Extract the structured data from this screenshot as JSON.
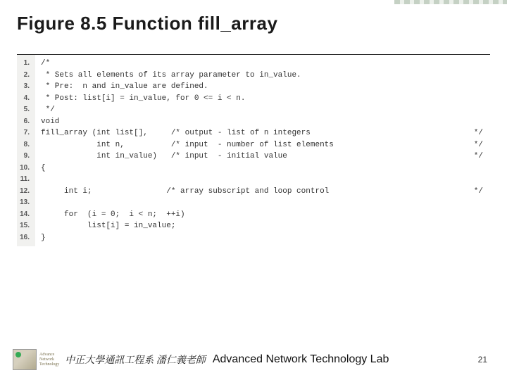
{
  "title": "Figure 8.5  Function fill_array",
  "lines": [
    {
      "n": "1.",
      "l": "/*"
    },
    {
      "n": "2.",
      "l": " * Sets all elements of its array parameter to in_value."
    },
    {
      "n": "3.",
      "l": " * Pre:  n and in_value are defined."
    },
    {
      "n": "4.",
      "l": " * Post: list[i] = in_value, for 0 <= i < n."
    },
    {
      "n": "5.",
      "l": " */"
    },
    {
      "n": "6.",
      "l": "void"
    },
    {
      "n": "7.",
      "l": "fill_array (int list[],     /* output - list of n integers",
      "r": "*/"
    },
    {
      "n": "8.",
      "l": "            int n,          /* input  - number of list elements",
      "r": "*/"
    },
    {
      "n": "9.",
      "l": "            int in_value)   /* input  - initial value",
      "r": "*/"
    },
    {
      "n": "10.",
      "l": "{"
    },
    {
      "n": "11.",
      "l": ""
    },
    {
      "n": "12.",
      "l": "     int i;                /* array subscript and loop control",
      "r": "*/"
    },
    {
      "n": "13.",
      "l": ""
    },
    {
      "n": "14.",
      "l": "     for  (i = 0;  i < n;  ++i)"
    },
    {
      "n": "15.",
      "l": "          list[i] = in_value;"
    },
    {
      "n": "16.",
      "l": "}"
    }
  ],
  "footer": {
    "logo_lines": [
      "Advance",
      "Network",
      "Technology"
    ],
    "cn": "中正大學通訊工程系 潘仁義老師",
    "en": "Advanced Network Technology Lab",
    "page": "21"
  }
}
